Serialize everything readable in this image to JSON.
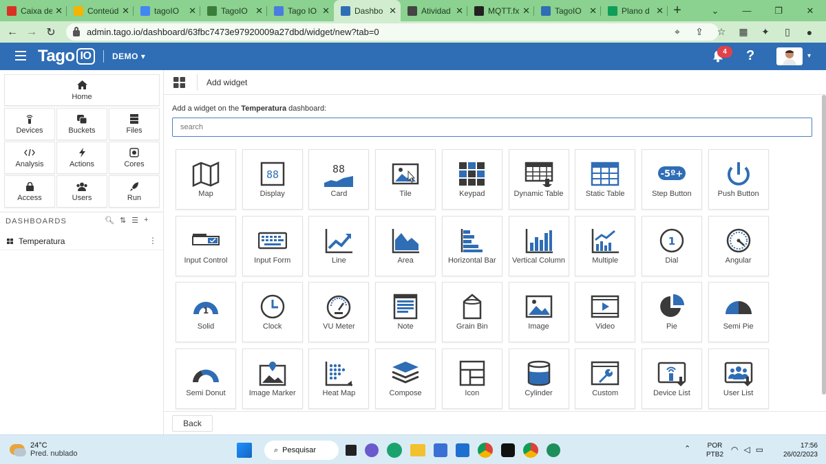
{
  "browser": {
    "tabs": [
      {
        "label": "Caixa de",
        "icon": "gmail-icon",
        "color": "#d93025"
      },
      {
        "label": "Conteúd",
        "icon": "drive-icon",
        "color": "#f4b400"
      },
      {
        "label": "tagoIO",
        "icon": "google-icon",
        "color": "#4285f4"
      },
      {
        "label": "TagoIO",
        "icon": "leaf-icon",
        "color": "#3a7d3a"
      },
      {
        "label": "Tago IO",
        "icon": "docs-icon",
        "color": "#4a7be0"
      },
      {
        "label": "Dashbo",
        "icon": "tago-icon",
        "color": "#2f6db5"
      },
      {
        "label": "Atividad",
        "icon": "classroom-icon",
        "color": "#444444"
      },
      {
        "label": "MQTT.fx",
        "icon": "s-icon",
        "color": "#222222"
      },
      {
        "label": "TagoIO",
        "icon": "tago-icon",
        "color": "#2f6db5"
      },
      {
        "label": "Plano d",
        "icon": "sheets-icon",
        "color": "#0f9d58"
      }
    ],
    "url": "admin.tago.io/dashboard/63fbc7473e97920009a27dbd/widget/new?tab=0"
  },
  "header": {
    "logo_text": "Tago",
    "logo_box": "IO",
    "profile": "DEMO",
    "notifications": "4"
  },
  "sidebar": {
    "home": "Home",
    "items": [
      "Devices",
      "Buckets",
      "Files",
      "Analysis",
      "Actions",
      "Cores",
      "Access",
      "Users",
      "Run"
    ],
    "dashboards_label": "DASHBOARDS",
    "dashboards": [
      "Temperatura"
    ]
  },
  "main": {
    "title": "Add widget",
    "intro_prefix": "Add a widget on the ",
    "intro_dashboard": "Temperatura",
    "intro_suffix": " dashboard:",
    "search_placeholder": "search",
    "back_label": "Back",
    "widgets": [
      "Map",
      "Display",
      "Card",
      "Tile",
      "Keypad",
      "Dynamic Table",
      "Static Table",
      "Step Button",
      "Push Button",
      "Input Control",
      "Input Form",
      "Line",
      "Area",
      "Horizontal Bar",
      "Vertical Column",
      "Multiple",
      "Dial",
      "Angular",
      "Solid",
      "Clock",
      "VU Meter",
      "Note",
      "Grain Bin",
      "Image",
      "Video",
      "Pie",
      "Semi Pie",
      "Semi Donut",
      "Image Marker",
      "Heat Map",
      "Compose",
      "Icon",
      "Cylinder",
      "Custom",
      "Device List",
      "User List"
    ],
    "widget_glyphs": {
      "display": "88",
      "card": "88",
      "step": "-5º+",
      "dial": "1",
      "solid": "1"
    }
  },
  "taskbar": {
    "temp": "24°C",
    "weather": "Pred. nublado",
    "search": "Pesquisar",
    "lang1": "POR",
    "lang2": "PTB2",
    "time": "17:56",
    "date": "26/02/2023"
  },
  "colors": {
    "brand": "#2f6db5",
    "icon_dark": "#3a3a3a",
    "icon_blue": "#2f6db5",
    "tabstrip": "#8bd18f"
  }
}
